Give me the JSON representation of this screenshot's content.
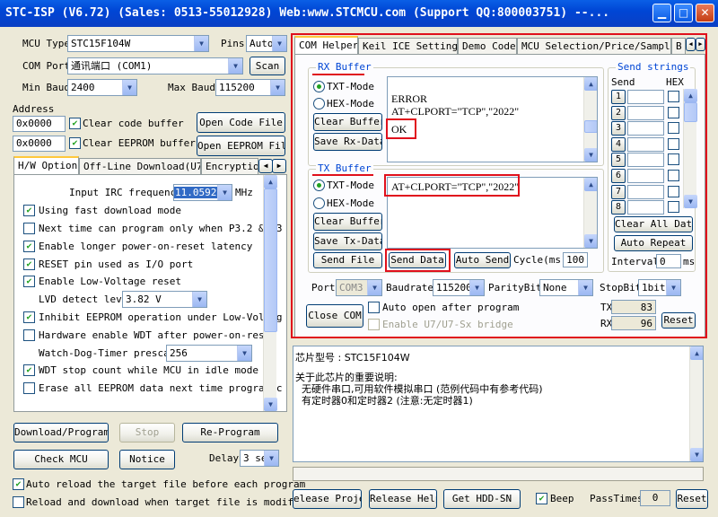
{
  "window": {
    "title": "STC-ISP (V6.72) (Sales: 0513-55012928) Web:www.STCMCU.com (Support QQ:800003751) --..."
  },
  "left": {
    "mcu_type_label": "MCU Type",
    "mcu_type_value": "STC15F104W",
    "pins_label": "Pins",
    "pins_value": "Auto",
    "com_port_label": "COM Port",
    "com_port_value": "通讯端口 (COM1)",
    "scan_button": "Scan",
    "min_baud_label": "Min Baud",
    "min_baud_value": "2400",
    "max_baud_label": "Max Baud",
    "max_baud_value": "115200",
    "address_label": "Address",
    "code_addr": "0x0000",
    "clear_code_label": "Clear code buffer",
    "open_code_button": "Open Code File",
    "eeprom_addr": "0x0000",
    "clear_eeprom_label": "Clear EEPROM buffer",
    "open_eeprom_button": "Open EEPROM File",
    "tabs": [
      "H/W Option",
      "Off-Line Download(U7)",
      "Encryption"
    ],
    "options": {
      "irc_label": "Input IRC frequency",
      "irc_value": "11.0592",
      "irc_unit": "MHz",
      "fast_download": "Using fast download mode",
      "p32_p3": "Next time can program only when P3.2 & P3",
      "longer_reset": "Enable longer power-on-reset latency",
      "reset_pin": "RESET pin used as I/O port",
      "low_voltage": "Enable Low-Voltage reset",
      "lvd_label": "LVD detect leve",
      "lvd_value": "3.82 V",
      "inhibit_eeprom": "Inhibit EEPROM operation under Low-Voltag",
      "hw_wdt": "Hardware enable WDT after power-on-reset",
      "wdt_prescale_label": "Watch-Dog-Timer prescal",
      "wdt_prescale_value": "256",
      "wdt_idle": "WDT stop count while MCU in idle mode",
      "erase_eeprom": "Erase all EEPROM data next time program c"
    },
    "download_button": "Download/Program",
    "stop_button": "Stop",
    "reprogram_button": "Re-Program",
    "check_mcu_button": "Check MCU",
    "notice_button": "Notice",
    "delay_label": "Delay",
    "delay_value": "3 se",
    "auto_reload": "Auto reload the target file before each program",
    "reload_modified": "Reload and download when target file is modified"
  },
  "right": {
    "tabs": [
      "COM Helper",
      "Keil ICE Settings",
      "Demo Code",
      "MCU Selection/Price/Samples",
      "B"
    ],
    "rx": {
      "title": "RX Buffer",
      "txt_mode": "TXT-Mode",
      "hex_mode": "HEX-Mode",
      "clear_button": "Clear Buffer",
      "save_button": "Save Rx-Data",
      "line1": "ERROR",
      "line2": "AT+CLPORT=\"TCP\",\"2022\"",
      "line3": "OK"
    },
    "tx": {
      "title": "TX Buffer",
      "txt_mode": "TXT-Mode",
      "hex_mode": "HEX-Mode",
      "clear_button": "Clear Buffer",
      "save_button": "Save Tx-Data",
      "text": "AT+CLPORT=\"TCP\",\"2022\""
    },
    "send_file_button": "Send File",
    "send_data_button": "Send Data",
    "auto_send_button": "Auto Send",
    "cycle_label": "Cycle(ms)",
    "cycle_value": "100",
    "send_strings": {
      "title": "Send strings",
      "send_header": "Send",
      "hex_header": "HEX",
      "numbers": [
        "1",
        "2",
        "3",
        "4",
        "5",
        "6",
        "7",
        "8"
      ],
      "clear_all_button": "Clear All Data",
      "auto_repeat_button": "Auto Repeat",
      "interval_label": "Interval",
      "interval_value": "0",
      "interval_unit": "ms"
    },
    "port_label": "Port",
    "port_value": "COM3",
    "baudrate_label": "Baudrate",
    "baudrate_value": "115200",
    "parity_label": "ParityBit",
    "parity_value": "None",
    "stopbit_label": "StopBit",
    "stopbit_value": "1bit",
    "close_com_button": "Close COM",
    "auto_open_label": "Auto open after program",
    "enable_bridge_label": "Enable U7/U7-Sx bridge",
    "tx_label": "TX",
    "tx_count": "83",
    "rx_label": "RX",
    "rx_count": "96",
    "reset_button": "Reset"
  },
  "info": {
    "chip_line": "芯片型号 : STC15F104W",
    "notes_title": "关于此芯片的重要说明:",
    "note1": "  无硬件串口,可用软件模拟串口 (范例代码中有参考代码)",
    "note2": "  有定时器0和定时器2 (注意:无定时器1)"
  },
  "bottom": {
    "release_project_button": "elease Projec",
    "release_help_button": "Release Help",
    "get_hdd_button": "Get HDD-SN",
    "beep_label": "Beep",
    "passtimes_label": "PassTimes",
    "passtimes_value": "0",
    "reset_button": "Reset"
  }
}
